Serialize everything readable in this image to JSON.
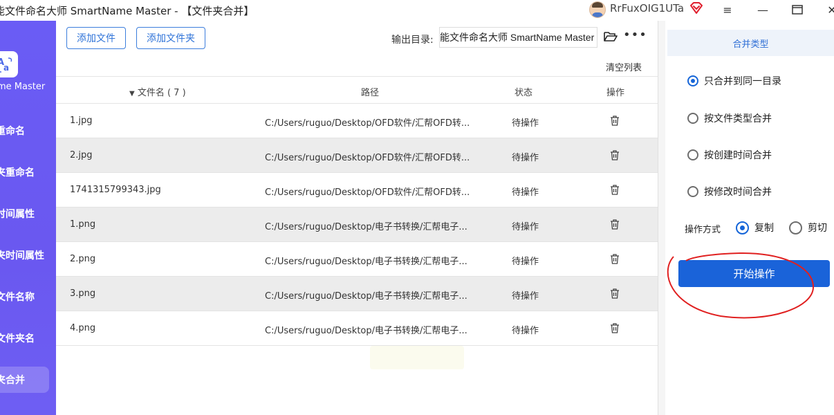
{
  "titlebar": {
    "title": "能文件命名大师 SmartName Master - 【文件夹合并】",
    "username": "RrFuxOIG1UTa",
    "minimize_glyph": "—",
    "menu_glyph": "≡",
    "maximize_glyph": "▭",
    "close_glyph": "✕"
  },
  "sidebar": {
    "logo_name": "me Master",
    "items": [
      {
        "label": "重命名",
        "active": false
      },
      {
        "label": "夹重命名",
        "active": false
      },
      {
        "label": "时间属性",
        "active": false
      },
      {
        "label": "夹时间属性",
        "active": false
      },
      {
        "label": "文件名称",
        "active": false
      },
      {
        "label": "文件夹名",
        "active": false
      },
      {
        "label": "夹合并",
        "active": true
      }
    ]
  },
  "toolbar": {
    "add_file": "添加文件",
    "add_folder": "添加文件夹",
    "output_label": "输出目录:",
    "output_value": "能文件命名大师 SmartName Master",
    "more_glyph": "•••",
    "clear_list": "清空列表"
  },
  "table": {
    "headers": {
      "filename": "文件名 ( 7 )",
      "path": "路径",
      "status": "状态",
      "action": "操作"
    },
    "rows": [
      {
        "name": "1.jpg",
        "path": "C:/Users/ruguo/Desktop/OFD软件/汇帮OFD转...",
        "status": "待操作"
      },
      {
        "name": "2.jpg",
        "path": "C:/Users/ruguo/Desktop/OFD软件/汇帮OFD转...",
        "status": "待操作"
      },
      {
        "name": "1741315799343.jpg",
        "path": "C:/Users/ruguo/Desktop/OFD软件/汇帮OFD转...",
        "status": "待操作"
      },
      {
        "name": "1.png",
        "path": "C:/Users/ruguo/Desktop/电子书转换/汇帮电子...",
        "status": "待操作"
      },
      {
        "name": "2.png",
        "path": "C:/Users/ruguo/Desktop/电子书转换/汇帮电子...",
        "status": "待操作"
      },
      {
        "name": "3.png",
        "path": "C:/Users/ruguo/Desktop/电子书转换/汇帮电子...",
        "status": "待操作"
      },
      {
        "name": "4.png",
        "path": "C:/Users/ruguo/Desktop/电子书转换/汇帮电子...",
        "status": "待操作"
      }
    ]
  },
  "panel": {
    "header": "合并类型",
    "merge_options": [
      {
        "label": "只合并到同一目录",
        "selected": true
      },
      {
        "label": "按文件类型合并",
        "selected": false
      },
      {
        "label": "按创建时间合并",
        "selected": false
      },
      {
        "label": "按修改时间合并",
        "selected": false
      }
    ],
    "op_mode_label": "操作方式",
    "op_copy": "复制",
    "op_cut": "剪切",
    "op_selected": "复制",
    "start_button": "开始操作"
  },
  "colors": {
    "sidebar": "#6a5cf5",
    "accent": "#1a63d9",
    "annotation": "#e02020"
  }
}
